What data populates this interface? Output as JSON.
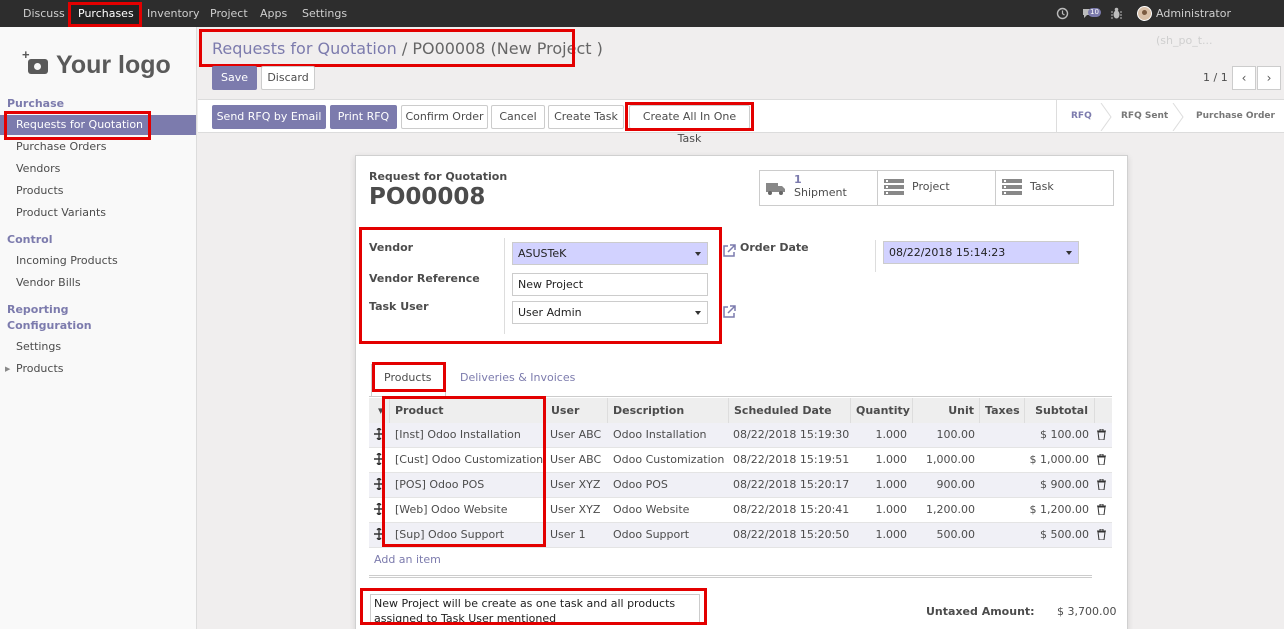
{
  "topbar": {
    "menus": [
      "Discuss",
      "Purchases",
      "Inventory",
      "Project",
      "Apps",
      "Settings"
    ],
    "active_menu": "Purchases",
    "message_count": "10",
    "user": "Administrator (sh_po_t..."
  },
  "sidebar": {
    "logo_text": "Your logo",
    "sections": [
      {
        "title": "Purchase",
        "items": [
          "Requests for Quotation",
          "Purchase Orders",
          "Vendors",
          "Products",
          "Product Variants"
        ]
      },
      {
        "title": "Control",
        "items": [
          "Incoming Products",
          "Vendor Bills"
        ]
      },
      {
        "title": "Reporting",
        "items": []
      },
      {
        "title": "Configuration",
        "items": [
          "Settings",
          "Products"
        ]
      }
    ],
    "active_item": "Requests for Quotation"
  },
  "breadcrumb": {
    "parent": "Requests for Quotation",
    "separator": "/",
    "current": "PO00008 (New Project )"
  },
  "actions": {
    "save": "Save",
    "discard": "Discard"
  },
  "pager": {
    "text": "1 / 1"
  },
  "header_buttons": [
    "Send RFQ by Email",
    "Print RFQ",
    "Confirm Order",
    "Cancel",
    "Create Task",
    "Create All In One Task"
  ],
  "stages": [
    "RFQ",
    "RFQ Sent",
    "Purchase Order"
  ],
  "active_stage": "RFQ",
  "form": {
    "subtitle": "Request for Quotation",
    "number": "PO00008",
    "smart_buttons": [
      {
        "count": "1",
        "label": "Shipment",
        "icon": "truck-icon"
      },
      {
        "count": "",
        "label": "Project",
        "icon": "list-icon"
      },
      {
        "count": "",
        "label": "Task",
        "icon": "list-icon"
      }
    ],
    "vendor_label": "Vendor",
    "vendor_value": "ASUSTeK",
    "vendor_ref_label": "Vendor Reference",
    "vendor_ref_value": "New Project",
    "task_user_label": "Task User",
    "task_user_value": "User Admin",
    "order_date_label": "Order Date",
    "order_date_value": "08/22/2018 15:14:23"
  },
  "tabs": [
    "Products",
    "Deliveries & Invoices"
  ],
  "active_tab": "Products",
  "table": {
    "columns": [
      "Product",
      "User",
      "Description",
      "Scheduled Date",
      "Quantity",
      "Unit Price",
      "Taxes",
      "Subtotal"
    ],
    "rows": [
      {
        "product": "[Inst] Odoo Installation",
        "user": "User ABC",
        "description": "Odoo Installation",
        "date": "08/22/2018 15:19:30",
        "qty": "1.000",
        "price": "100.00",
        "taxes": "",
        "subtotal": "$ 100.00"
      },
      {
        "product": "[Cust] Odoo Customization",
        "user": "User ABC",
        "description": "Odoo Customization",
        "date": "08/22/2018 15:19:51",
        "qty": "1.000",
        "price": "1,000.00",
        "taxes": "",
        "subtotal": "$ 1,000.00"
      },
      {
        "product": "[POS] Odoo POS",
        "user": "User XYZ",
        "description": "Odoo POS",
        "date": "08/22/2018 15:20:17",
        "qty": "1.000",
        "price": "900.00",
        "taxes": "",
        "subtotal": "$ 900.00"
      },
      {
        "product": "[Web] Odoo Website",
        "user": "User XYZ",
        "description": "Odoo Website",
        "date": "08/22/2018 15:20:41",
        "qty": "1.000",
        "price": "1,200.00",
        "taxes": "",
        "subtotal": "$ 1,200.00"
      },
      {
        "product": "[Sup] Odoo Support",
        "user": "User 1",
        "description": "Odoo Support",
        "date": "08/22/2018 15:20:50",
        "qty": "1.000",
        "price": "500.00",
        "taxes": "",
        "subtotal": "$ 500.00"
      }
    ],
    "add_item": "Add an item"
  },
  "notes": "New Project will be create as one task and all products assigned to Task User mentioned",
  "totals": {
    "untaxed_label": "Untaxed Amount:",
    "untaxed_value": "$ 3,700.00"
  },
  "colors": {
    "accent": "#7c7bad",
    "highlight": "#e30000",
    "topbar": "#2d2d2d"
  }
}
